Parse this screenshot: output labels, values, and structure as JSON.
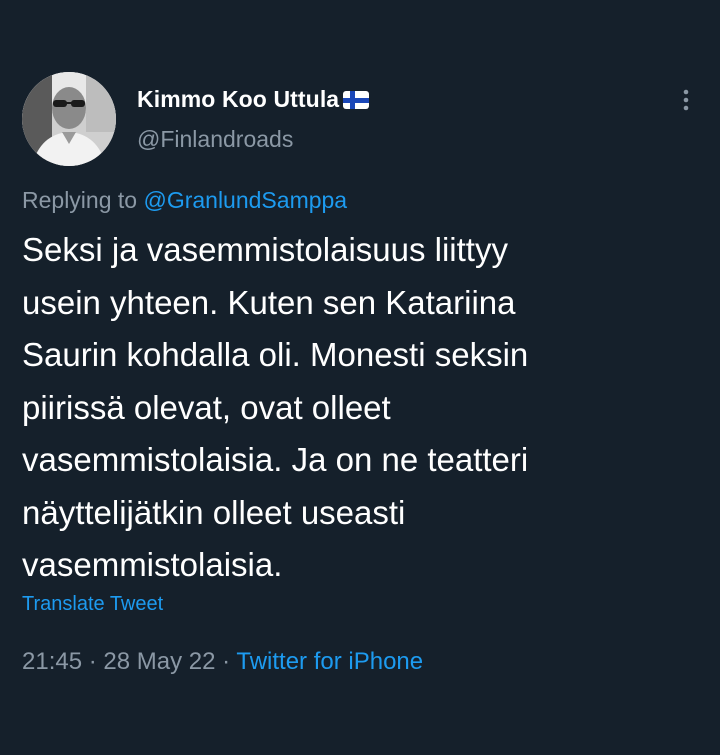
{
  "author": {
    "display_name": "Kimmo Koo Uttula",
    "handle": "@Finlandroads",
    "avatar_icon": "profile-photo",
    "flag_icon": "finland-flag-icon"
  },
  "more_icon": "more-vertical-icon",
  "reply": {
    "prefix": "Replying to ",
    "mention": "@GranlundSamppa"
  },
  "tweet": {
    "text": "Seksi ja vasemmistolaisuus liittyy\nusein yhteen. Kuten sen Katariina\nSaurin kohdalla oli. Monesti seksin\npiirissä olevat, ovat olleet\nvasemmistolaisia. Ja on ne teatteri\nnäyttelijätkin olleet useasti\nvasemmistolaisia.",
    "translate_label": "Translate Tweet"
  },
  "meta": {
    "time": "21:45",
    "separator": " · ",
    "date": "28 May 22",
    "source": "Twitter for iPhone"
  },
  "colors": {
    "background": "#15202b",
    "accent": "#1d9bf0",
    "secondary_text": "#8b98a5",
    "primary_text": "#ffffff"
  }
}
